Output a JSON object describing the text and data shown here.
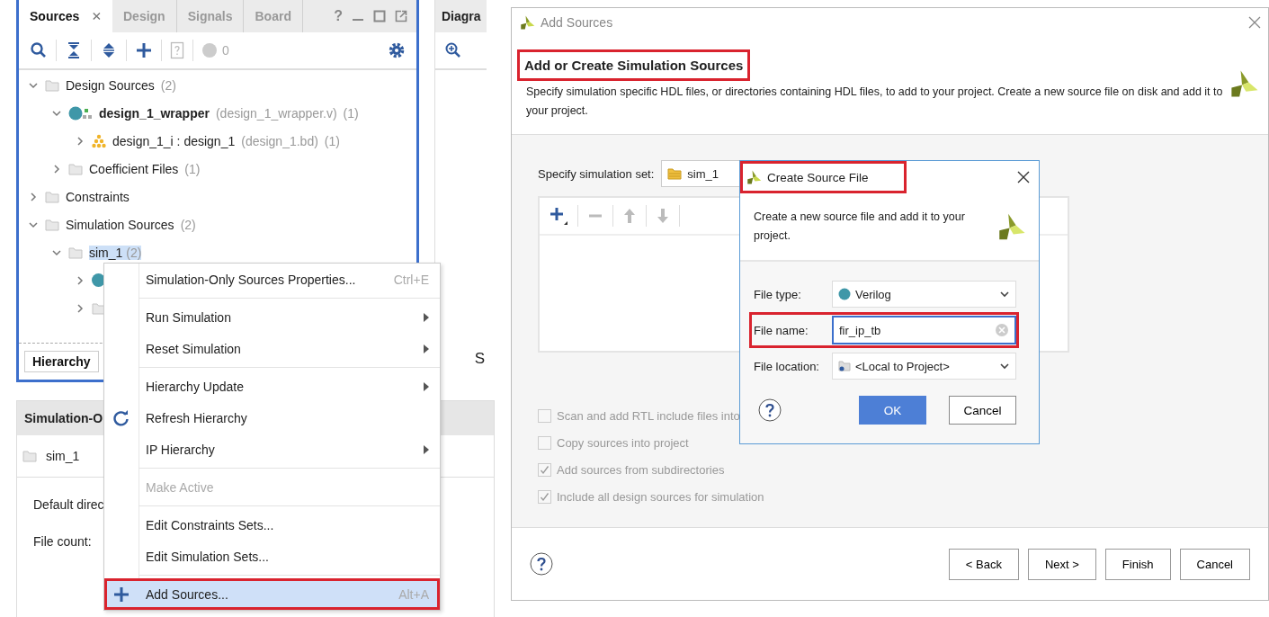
{
  "sources_panel": {
    "tabs": [
      {
        "label": "Sources",
        "selected": true
      },
      {
        "label": "Design",
        "selected": false
      },
      {
        "label": "Signals",
        "selected": false
      },
      {
        "label": "Board",
        "selected": false
      }
    ],
    "help_glyph": "?",
    "issue_count": "0",
    "tree": [
      {
        "label": "Design Sources",
        "count": "(2)",
        "kind": "folder",
        "expanded": true,
        "top": false,
        "selected": false,
        "children": [
          {
            "label": "design_1_wrapper",
            "detail": "(design_1_wrapper.v)",
            "count": "(1)",
            "kind": "module",
            "expanded": true,
            "top": true,
            "selected": false,
            "children": [
              {
                "label": "design_1_i : design_1",
                "detail": "(design_1.bd)",
                "count": "(1)",
                "kind": "blockdesign",
                "expanded": false,
                "top": false,
                "selected": false
              }
            ]
          },
          {
            "label": "Coefficient Files",
            "count": "(1)",
            "kind": "folder",
            "expanded": false,
            "top": false,
            "selected": false
          }
        ]
      },
      {
        "label": "Constraints",
        "kind": "folder",
        "expanded": false,
        "top": false,
        "selected": false
      },
      {
        "label": "Simulation Sources",
        "count": "(2)",
        "kind": "folder",
        "expanded": true,
        "top": false,
        "selected": false,
        "children": [
          {
            "label": "sim_1",
            "count": "(2)",
            "kind": "folder",
            "expanded": true,
            "top": false,
            "selected": true,
            "children": [
              {
                "kind": "module",
                "expanded": false
              },
              {
                "kind": "folder",
                "expanded": false
              }
            ]
          }
        ]
      }
    ],
    "bottom_tabs": [
      {
        "label": "Hierarchy",
        "selected": true
      }
    ]
  },
  "diagram_panel": {
    "title": "Diagra",
    "side_letter": "S"
  },
  "properties_panel": {
    "title": "Simulation-O",
    "set": "sim_1",
    "fields": [
      "Default direc",
      "File count:"
    ]
  },
  "context_menu": {
    "groups": [
      [
        {
          "label": "Simulation-Only Sources Properties...",
          "shortcut": "Ctrl+E",
          "submenu": false,
          "disabled": false,
          "selected": false,
          "marked": false
        }
      ],
      [
        {
          "label": "Run Simulation",
          "submenu": true,
          "disabled": false,
          "selected": false,
          "marked": false
        },
        {
          "label": "Reset Simulation",
          "submenu": true,
          "disabled": false,
          "selected": false,
          "marked": false
        }
      ],
      [
        {
          "label": "Hierarchy Update",
          "submenu": true,
          "disabled": false,
          "selected": false,
          "marked": false
        },
        {
          "label": "Refresh Hierarchy",
          "submenu": false,
          "disabled": false,
          "selected": false,
          "marked": false
        },
        {
          "label": "IP Hierarchy",
          "submenu": true,
          "disabled": false,
          "selected": false,
          "marked": false
        }
      ],
      [
        {
          "label": "Make Active",
          "submenu": false,
          "disabled": true,
          "selected": false,
          "marked": false
        }
      ],
      [
        {
          "label": "Edit Constraints Sets...",
          "submenu": false,
          "disabled": false,
          "selected": false,
          "marked": false
        },
        {
          "label": "Edit Simulation Sets...",
          "submenu": false,
          "disabled": false,
          "selected": false,
          "marked": false
        }
      ],
      [
        {
          "label": "Add Sources...",
          "shortcut": "Alt+A",
          "submenu": false,
          "disabled": false,
          "selected": true,
          "marked": true
        }
      ]
    ]
  },
  "add_sources": {
    "title": "Add Sources",
    "heading": "Add or Create Simulation Sources",
    "heading_marked": true,
    "description": "Specify simulation specific HDL files, or directories containing HDL files, to add to your project. Create a new source file on disk and add it to your project.",
    "sim_set_label": "Specify simulation set:",
    "sim_set": "sim_1",
    "options": [
      {
        "label": "Scan and add RTL include files into",
        "checked": false,
        "disabled": true
      },
      {
        "label": "Copy sources into project",
        "checked": false,
        "disabled": true
      },
      {
        "label": "Add sources from subdirectories",
        "checked": true,
        "disabled": true
      },
      {
        "label": "Include all design sources for simulation",
        "checked": true,
        "disabled": true
      }
    ],
    "buttons": [
      "< Back",
      "Next >",
      "Finish",
      "Cancel"
    ]
  },
  "create_file": {
    "title": "Create Source File",
    "title_marked": true,
    "description": "Create a new source file and add it to your project.",
    "fields": [
      {
        "kind": "select",
        "label": "File type:",
        "value": "Verilog",
        "marked": false
      },
      {
        "kind": "input",
        "label": "File name:",
        "value": "fir_ip_tb",
        "marked": true
      },
      {
        "kind": "select",
        "label": "File location:",
        "value": "<Local to Project>",
        "marked": false
      }
    ],
    "buttons": [
      {
        "label": "OK",
        "primary": true
      },
      {
        "label": "Cancel",
        "primary": false
      }
    ]
  }
}
